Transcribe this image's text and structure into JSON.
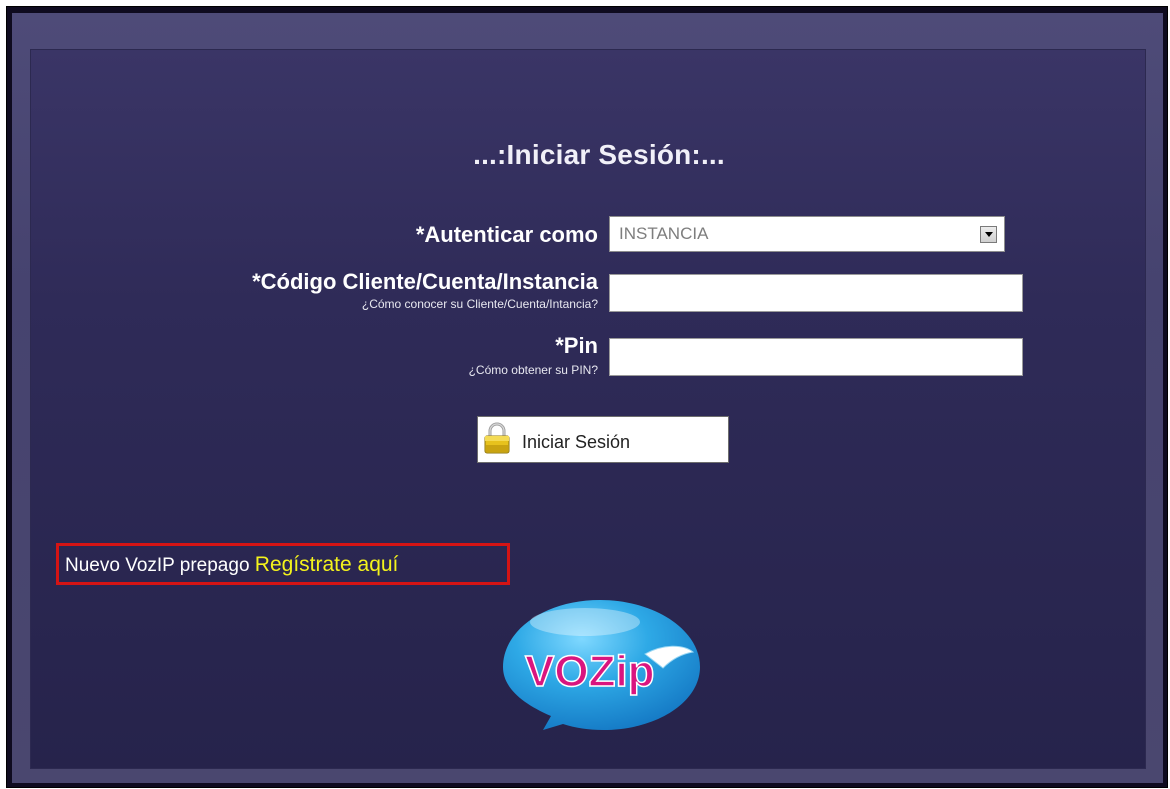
{
  "login": {
    "title": "...:Iniciar Sesión:...",
    "auth_label": "*Autenticar como",
    "auth_value": "INSTANCIA",
    "code_label": "*Código Cliente/Cuenta/Instancia",
    "code_help": "¿Cómo conocer su Cliente/Cuenta/Intancia?",
    "code_value": "",
    "pin_label": "*Pin",
    "pin_help": "¿Cómo obtener su PIN?",
    "pin_value": "",
    "submit_label": "Iniciar Sesión",
    "submit_icon": "lock-icon"
  },
  "register": {
    "text": "Nuevo VozIP prepago",
    "link": "Regístrate aquí"
  },
  "brand": {
    "logo_text": "VOZip"
  },
  "colors": {
    "panel": "#2f2b58",
    "frame": "#4e4b78",
    "link": "#f4f31c",
    "highlight_border": "#d51414"
  }
}
